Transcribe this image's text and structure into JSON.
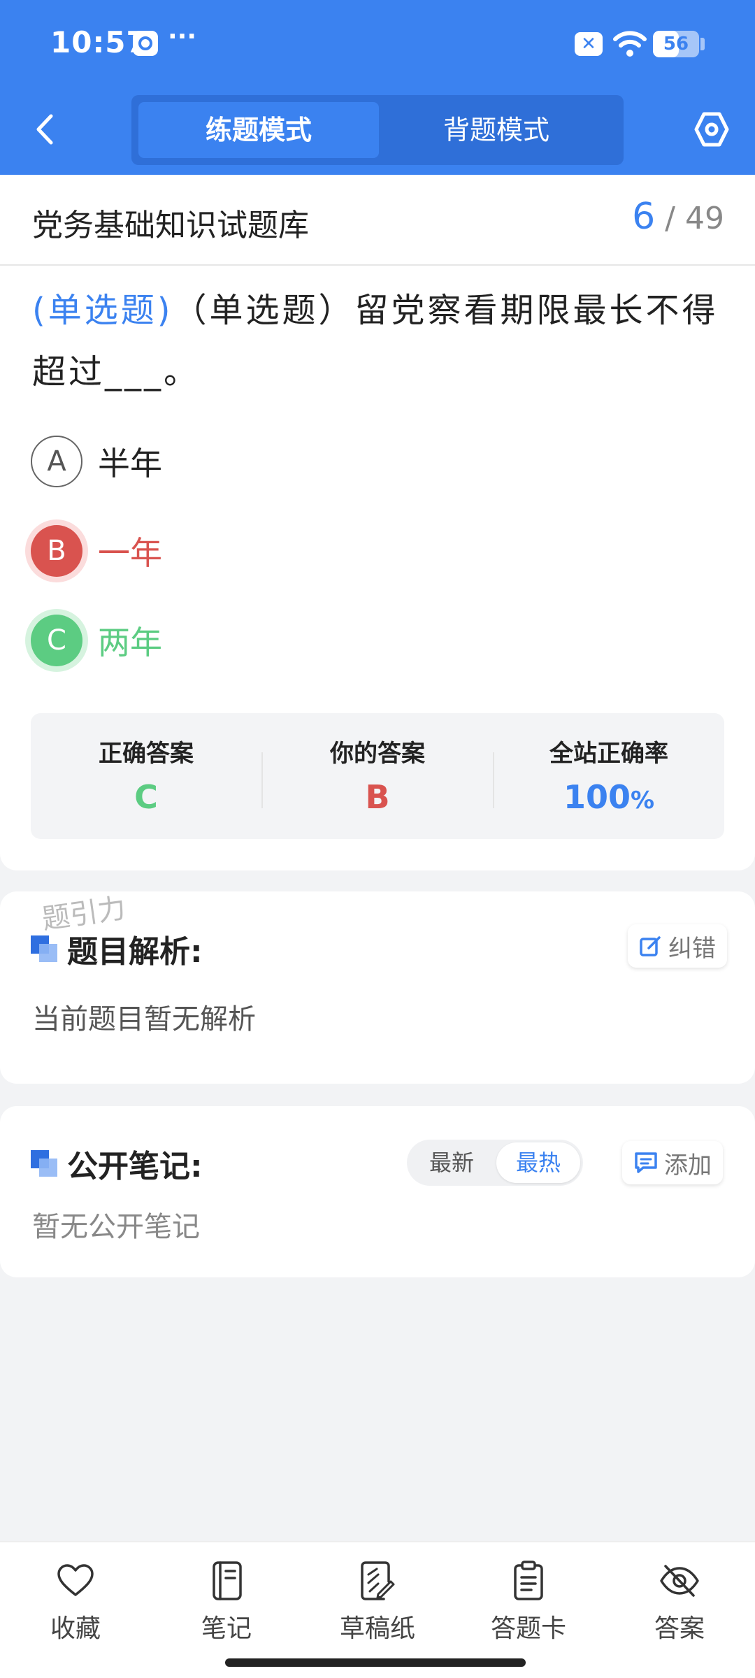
{
  "status_bar": {
    "time": "10:57",
    "more": "···",
    "battery": "56",
    "battery_level": 0.56
  },
  "header": {
    "tabs": [
      {
        "label": "练题模式",
        "active": true
      },
      {
        "label": "背题模式",
        "active": false
      }
    ],
    "icons": {
      "back": "chevron-left-icon",
      "settings": "hexagon-settings-icon"
    }
  },
  "bank": {
    "title": "党务基础知识试题库",
    "current": "6",
    "separator": "/",
    "total": "49"
  },
  "question": {
    "type_tag": "(单选题)",
    "text": "（单选题）留党察看期限最长不得超过___。"
  },
  "options": [
    {
      "letter": "A",
      "text": "半年",
      "state": "normal"
    },
    {
      "letter": "B",
      "text": "一年",
      "state": "wrong"
    },
    {
      "letter": "C",
      "text": "两年",
      "state": "correct"
    }
  ],
  "answer_summary": {
    "correct_label": "正确答案",
    "correct_value": "C",
    "yours_label": "你的答案",
    "yours_value": "B",
    "rate_label": "全站正确率",
    "rate_value": "100",
    "rate_unit": "%"
  },
  "analysis": {
    "watermark": "题引力",
    "title": "题目解析:",
    "correct_btn": "纠错",
    "body": "当前题目暂无解析"
  },
  "notes": {
    "title": "公开笔记:",
    "sort_newest": "最新",
    "sort_hottest": "最热",
    "add_btn": "添加",
    "body": "暂无公开笔记"
  },
  "toolbar": [
    {
      "label": "收藏",
      "icon": "heart-icon"
    },
    {
      "label": "笔记",
      "icon": "notebook-icon"
    },
    {
      "label": "草稿纸",
      "icon": "draft-paper-icon"
    },
    {
      "label": "答题卡",
      "icon": "answer-sheet-icon"
    },
    {
      "label": "答案",
      "icon": "eye-hidden-icon"
    }
  ],
  "colors": {
    "primary": "#3b82f0",
    "wrong": "#d9534f",
    "correct": "#5ccc82"
  }
}
